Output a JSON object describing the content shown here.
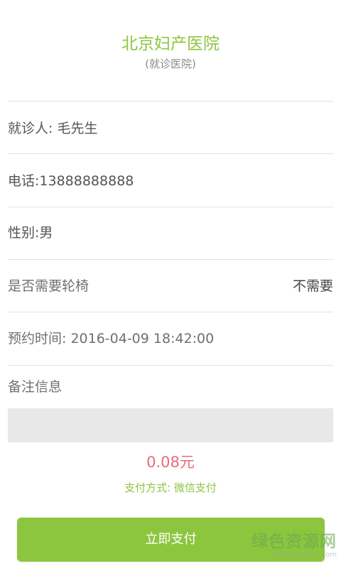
{
  "header": {
    "hospital_name": "北京妇产医院",
    "hospital_subtitle": "(就诊医院)"
  },
  "form": {
    "patient": "就诊人:  毛先生",
    "phone": "电话:13888888888",
    "gender": "性别:男",
    "wheelchair_label": "是否需要轮椅",
    "wheelchair_value": "不需要",
    "appointment_time": "预约时间:  2016-04-09 18:42:00",
    "remark_label": "备注信息",
    "remark_value": ""
  },
  "payment": {
    "price": "0.08元",
    "method": "支付方式:  微信支付",
    "button_label": "立即支付"
  },
  "watermark": {
    "main": "绿色资源网",
    "sub": "www.downcc.com"
  },
  "colors": {
    "accent_green": "#8cc63f",
    "price_pink": "#e86b7c",
    "divider": "#e3e3e3",
    "input_bg": "#e8e8e8"
  }
}
